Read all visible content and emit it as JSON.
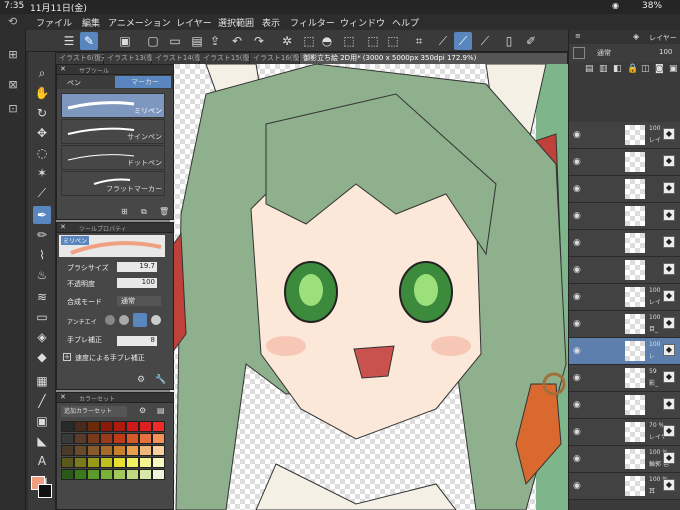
{
  "status": {
    "time": "7:35",
    "date": "11月11日(金)",
    "battery": "38%"
  },
  "menu": [
    "ファイル",
    "編集",
    "アニメーション",
    "レイヤー",
    "選択範囲",
    "表示",
    "フィルター",
    "ウィンドウ",
    "ヘルプ"
  ],
  "tabs": [
    "イラスト6(復元)",
    "イラスト13(復",
    "イラスト14(復",
    "イラスト15(復",
    "イラスト16(復",
    "御影立ち絵 2D用* (3000 x 5000px 350dpi 172.9%)"
  ],
  "subtool": {
    "group_title": "サブツール",
    "tabs": [
      "ペン",
      "マーカー"
    ],
    "brushes": [
      "ミリペン",
      "サインペン",
      "ドットペン",
      "フラットマーカー"
    ]
  },
  "tool_property": {
    "title": "ツールプロパティ",
    "brush_label": "ミリペン",
    "brush_size_label": "ブラシサイズ",
    "brush_size": "19.7",
    "opacity_label": "不透明度",
    "opacity": "100",
    "blend_label": "合成モード",
    "blend": "通常",
    "antialias_label": "アンチエイ",
    "stabilization_label": "手ブレ補正",
    "stabilization": "8",
    "speed_label": "速度による手ブレ補正"
  },
  "color_set": {
    "title": "カラーセット",
    "name": "追加カラーセット",
    "swatches": [
      "#2a2a2a",
      "#4a2a1a",
      "#6b2a0a",
      "#8a1a0a",
      "#b01a0a",
      "#d01a1a",
      "#e02020",
      "#f02a2a",
      "#3a3a3a",
      "#5a3a2a",
      "#7a3a1a",
      "#9a3a1a",
      "#c03a1a",
      "#d85a2a",
      "#e8703a",
      "#f4905a",
      "#4a3a2a",
      "#6b4a2a",
      "#8a5a2a",
      "#a86a2a",
      "#c8802a",
      "#e8a050",
      "#f0b878",
      "#f8d0a0",
      "#5a5a1a",
      "#7a7a1a",
      "#9a9a1a",
      "#c0c020",
      "#e8e030",
      "#f0f060",
      "#f4f490",
      "#f8f8c0",
      "#2a5a1a",
      "#3a7a1a",
      "#5a9a2a",
      "#7ab03a",
      "#a0c85a",
      "#c0d880",
      "#d8e8a8",
      "#eef4d8"
    ]
  },
  "layer_panel": {
    "title": "レイヤー",
    "blend": "通常",
    "opacity": "100",
    "layers": [
      {
        "pct": "100",
        "name": "レイ"
      },
      {
        "pct": "",
        "name": ""
      },
      {
        "pct": "",
        "name": ""
      },
      {
        "pct": "",
        "name": ""
      },
      {
        "pct": "",
        "name": ""
      },
      {
        "pct": "",
        "name": ""
      },
      {
        "pct": "100",
        "name": "レイ"
      },
      {
        "pct": "100",
        "name": "目_"
      },
      {
        "pct": "100",
        "name": "レ"
      },
      {
        "pct": "59",
        "name": "影_"
      },
      {
        "pct": "",
        "name": ""
      },
      {
        "pct": "70 %",
        "name": "レイヤ"
      },
      {
        "pct": "100 %",
        "name": "輪郭 色"
      },
      {
        "pct": "100 %",
        "name": "耳"
      }
    ]
  },
  "colors": {
    "accent": "#5a86c0",
    "main_color": "#f0a080",
    "sub_color": "#ffffff"
  }
}
